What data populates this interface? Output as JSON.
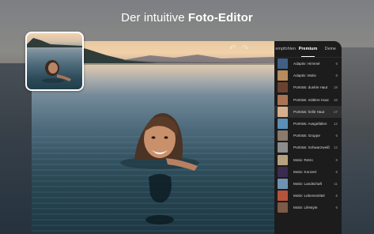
{
  "headline": {
    "regular": "Der intuitive ",
    "bold": "Foto-Editor"
  },
  "toolbar": {
    "undo_icon": "undo-icon",
    "redo_icon": "redo-icon"
  },
  "panel": {
    "tabs": [
      {
        "label": "empfohlen",
        "active": false
      },
      {
        "label": "Premium",
        "active": true
      },
      {
        "label": "Deine",
        "active": false
      }
    ],
    "presets": [
      {
        "name": "Adaptiv: Himmel",
        "count": "6",
        "thumb": "#3f5f86"
      },
      {
        "name": "Adaptiv: Motiv",
        "count": "6",
        "thumb": "#b88a5c"
      },
      {
        "name": "Porträts: dunkle Haut",
        "count": "18",
        "thumb": "#6a4330"
      },
      {
        "name": "Porträts: mittlere Haut",
        "count": "18",
        "thumb": "#a87454"
      },
      {
        "name": "Porträts: helle Haut",
        "count": "17",
        "thumb": "#d8b08e",
        "selected": true
      },
      {
        "name": "Porträts: Ausgefallen",
        "count": "12",
        "thumb": "#5a8fb6"
      },
      {
        "name": "Porträts: Gruppe",
        "count": "6",
        "thumb": "#8a7a6c"
      },
      {
        "name": "Porträts: Schwarzweiß",
        "count": "12",
        "thumb": "#8c8c8c"
      },
      {
        "name": "Motiv: Retro",
        "count": "6",
        "thumb": "#b6a27e"
      },
      {
        "name": "Motiv: Konzert",
        "count": "6",
        "thumb": "#3a2b4f"
      },
      {
        "name": "Motiv: Landschaft",
        "count": "11",
        "thumb": "#6e93b2"
      },
      {
        "name": "Motiv: Lebensmittel",
        "count": "6",
        "thumb": "#b5543b"
      },
      {
        "name": "Motiv: Lifestyle",
        "count": "6",
        "thumb": "#7a5a48"
      }
    ]
  },
  "colors": {
    "panel_bg": "#1c1c1c",
    "selected_row": "#2e2e2e"
  }
}
